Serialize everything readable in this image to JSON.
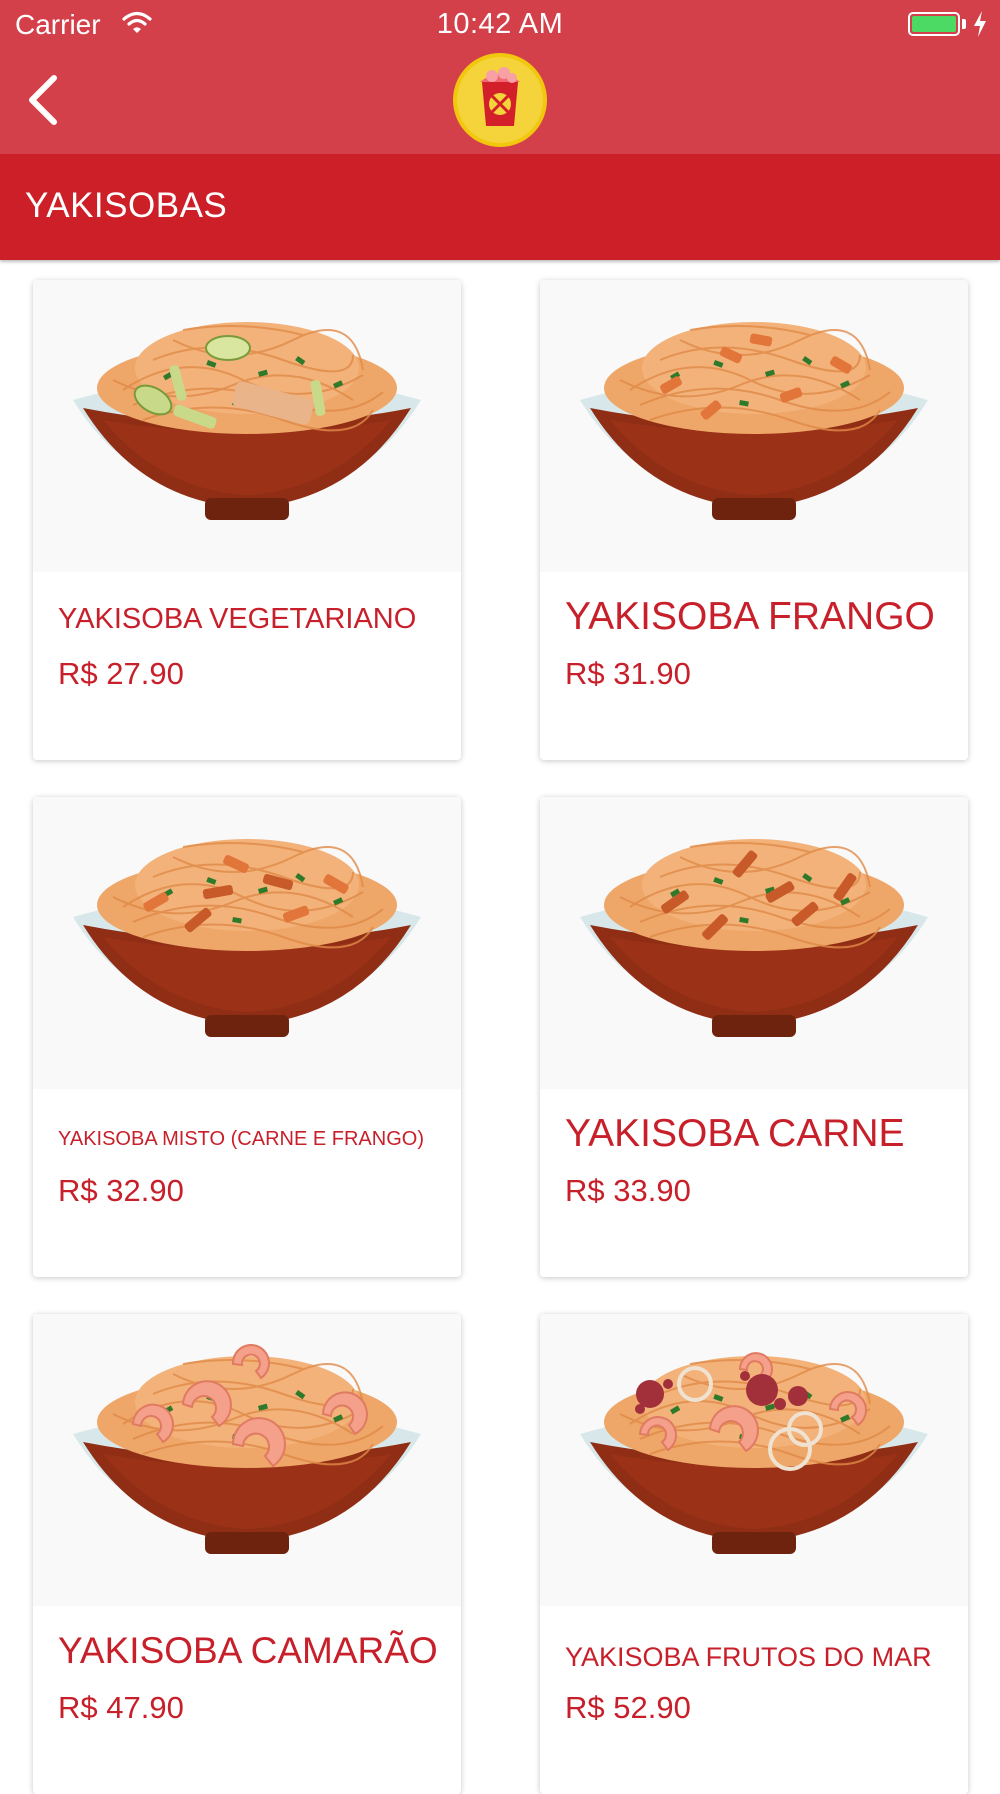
{
  "status_bar": {
    "carrier": "Carrier",
    "time": "10:42 AM",
    "battery_color": "#4cd964"
  },
  "nav": {
    "back_icon": "chevron-left-icon",
    "logo_icon": "noodle-box-logo",
    "background_color": "#d4404a"
  },
  "section": {
    "title": "YAKISOBAS",
    "background_color": "#cc1f27"
  },
  "products": [
    {
      "name": "YAKISOBA VEGETARIANO",
      "price": "R$ 27.90",
      "topping": "vegetables"
    },
    {
      "name": "YAKISOBA FRANGO",
      "price": "R$ 31.90",
      "topping": "chicken"
    },
    {
      "name": "YAKISOBA MISTO (CARNE E FRANGO)",
      "price": "R$ 32.90",
      "topping": "mixed"
    },
    {
      "name": "YAKISOBA CARNE",
      "price": "R$ 33.90",
      "topping": "beef"
    },
    {
      "name": "YAKISOBA CAMARÃO",
      "price": "R$ 47.90",
      "topping": "shrimp"
    },
    {
      "name": "YAKISOBA FRUTOS DO MAR",
      "price": "R$ 52.90",
      "topping": "seafood"
    }
  ],
  "accent_color": "#c8202a"
}
